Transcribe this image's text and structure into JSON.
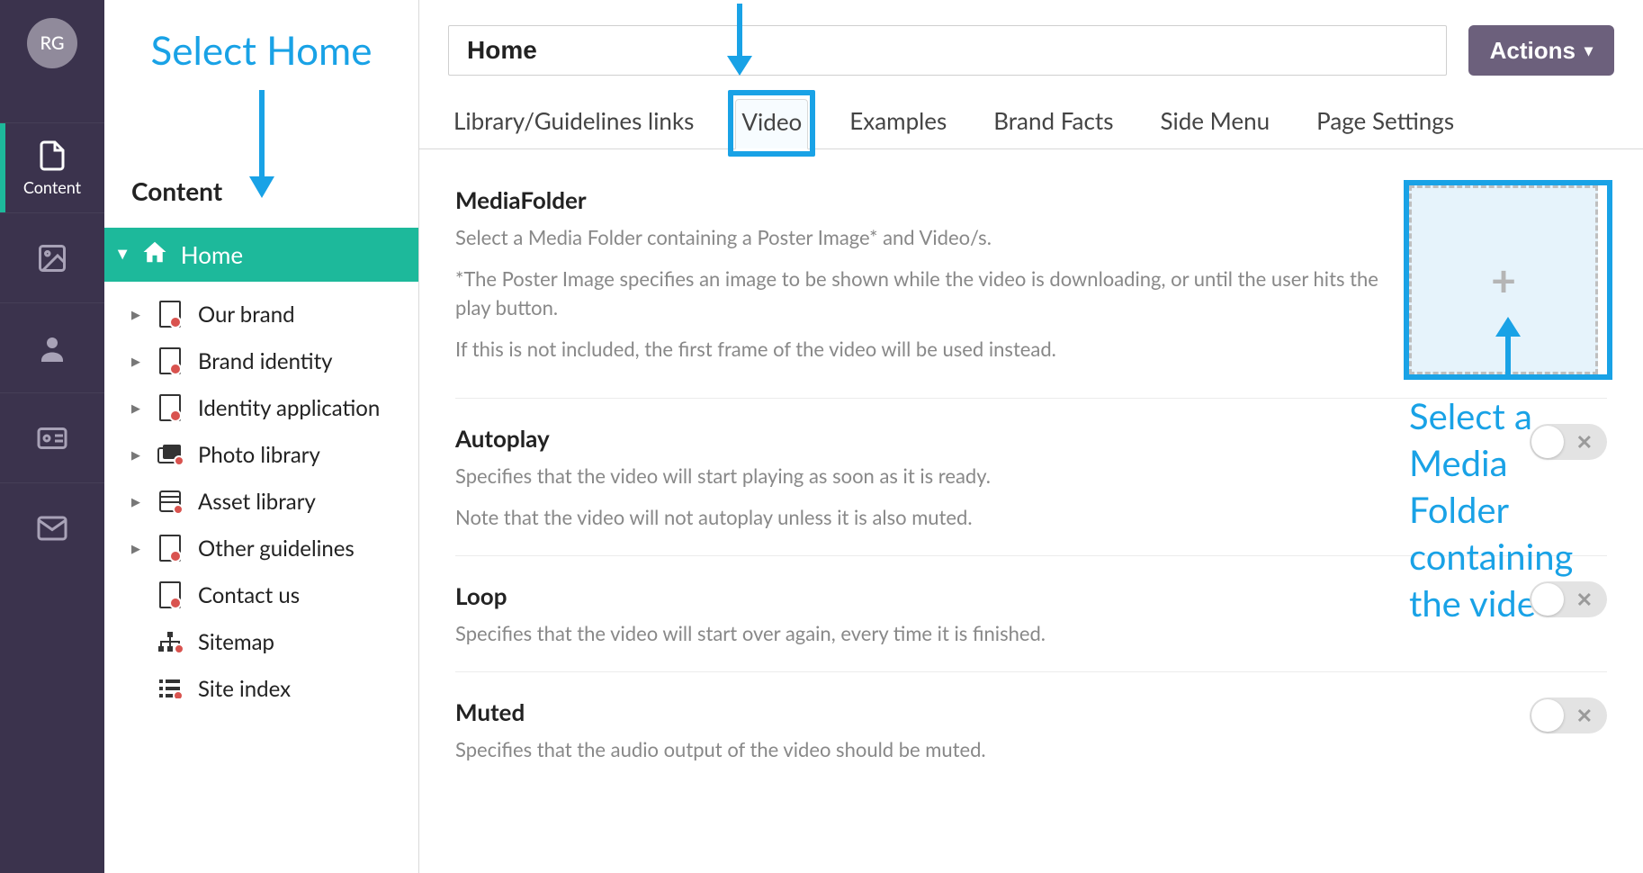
{
  "rail": {
    "avatar_initials": "RG",
    "active_label": "Content"
  },
  "tree": {
    "heading": "Content",
    "root": "Home",
    "children": [
      {
        "label": "Our brand",
        "expandable": true,
        "icon": "doc"
      },
      {
        "label": "Brand identity",
        "expandable": true,
        "icon": "doc"
      },
      {
        "label": "Identity application",
        "expandable": true,
        "icon": "doc"
      },
      {
        "label": "Photo library",
        "expandable": true,
        "icon": "photos"
      },
      {
        "label": "Asset library",
        "expandable": true,
        "icon": "assets"
      },
      {
        "label": "Other guidelines",
        "expandable": true,
        "icon": "doc"
      },
      {
        "label": "Contact us",
        "expandable": false,
        "icon": "doc"
      },
      {
        "label": "Sitemap",
        "expandable": false,
        "icon": "sitemap"
      },
      {
        "label": "Site index",
        "expandable": false,
        "icon": "index"
      }
    ]
  },
  "page": {
    "title_value": "Home",
    "actions_label": "Actions"
  },
  "tabs": [
    "Library/Guidelines links",
    "Video",
    "Examples",
    "Brand Facts",
    "Side Menu",
    "Page Settings"
  ],
  "active_tab": "Video",
  "settings": {
    "media": {
      "title": "MediaFolder",
      "line1": "Select a Media Folder containing a Poster Image* and Video/s.",
      "line2": "*The Poster Image specifies an image to be shown while the video is downloading, or until the user hits the play button.",
      "line3": "If this is not included, the first frame of the video will be used instead."
    },
    "autoplay": {
      "title": "Autoplay",
      "line1": "Specifies that the video will start playing as soon as it is ready.",
      "line2": "Note that the video will not autoplay unless it is also muted.",
      "value": false
    },
    "loop": {
      "title": "Loop",
      "line1": "Specifies that the video will start over again, every time it is finished.",
      "value": false
    },
    "muted": {
      "title": "Muted",
      "line1": "Specifies that the audio output of the video should be muted.",
      "value": false
    }
  },
  "annotations": {
    "select_home": "Select Home",
    "select_media": "Select a\nMedia\nFolder\ncontaining\nthe video"
  }
}
